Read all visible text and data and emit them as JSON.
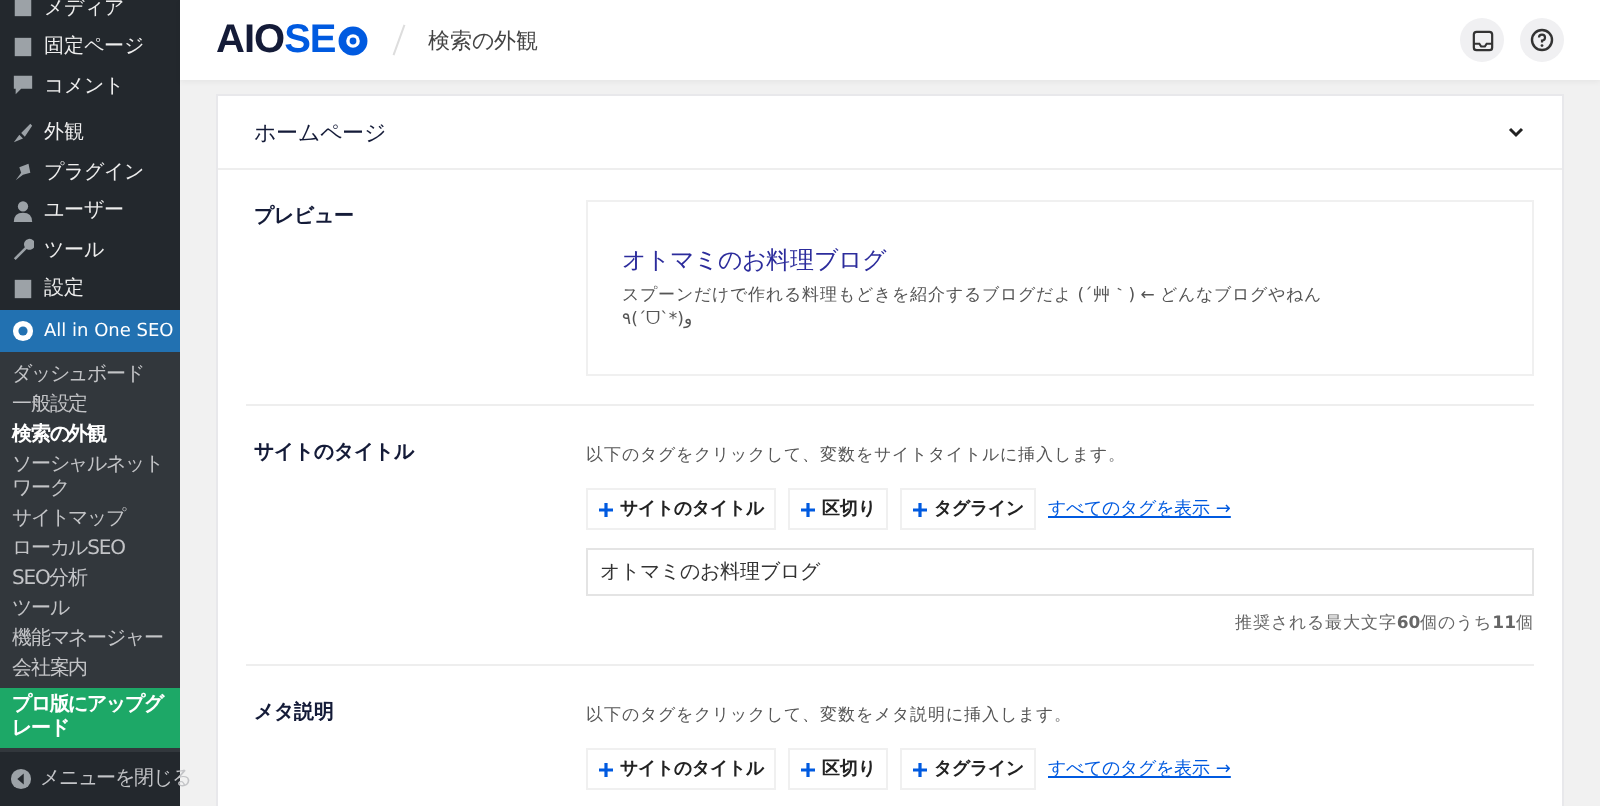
{
  "sidebar": {
    "items": [
      {
        "label": "メディア",
        "selected": false
      },
      {
        "label": "固定ページ",
        "selected": false
      },
      {
        "label": "コメント",
        "selected": false
      },
      {
        "label": "外観",
        "selected": false
      },
      {
        "label": "プラグイン",
        "selected": false
      },
      {
        "label": "ユーザー",
        "selected": false
      },
      {
        "label": "ツール",
        "selected": false
      },
      {
        "label": "設定",
        "selected": false
      },
      {
        "label": "All in One SEO",
        "selected": true
      }
    ],
    "submenu": [
      {
        "label": "ダッシュボード",
        "kind": "link",
        "selected": false
      },
      {
        "label": "一般設定",
        "kind": "link",
        "selected": false
      },
      {
        "label": "検索の外観",
        "kind": "link",
        "selected": true
      },
      {
        "label": "ソーシャルネットワーク",
        "kind": "link",
        "selected": false
      },
      {
        "label": "サイトマップ",
        "kind": "link",
        "selected": false
      },
      {
        "label": "ローカルSEO",
        "kind": "link",
        "selected": false
      },
      {
        "label": "SEO分析",
        "kind": "link",
        "selected": false
      },
      {
        "label": "ツール",
        "kind": "link",
        "selected": false
      },
      {
        "label": "機能マネージャー",
        "kind": "link",
        "selected": false
      },
      {
        "label": "会社案内",
        "kind": "link",
        "selected": false
      },
      {
        "label": "プロ版にアップグレード",
        "kind": "upgrade",
        "selected": false
      }
    ],
    "collapse": "メニューを閉じる"
  },
  "header": {
    "logo_dark": "AIO",
    "logo_blue": "SE",
    "page_title": "検索の外観"
  },
  "card": {
    "title": "ホームページ",
    "expanded": true,
    "preview": {
      "label": "プレビュー",
      "title": "オトマミのお料理ブログ",
      "description": "スプーンだけで作れる料理もどきを紹介するブログだよ (´艸｀) ← どんなブログやねん ٩(ˊᗜˋ*)و"
    },
    "site_title": {
      "label": "サイトのタイトル",
      "hint": "以下のタグをクリックして、変数をサイトタイトルに挿入します。",
      "tags": [
        "サイトのタイトル",
        "区切り",
        "タグライン"
      ],
      "view_all": "すべてのタグを表示 →",
      "value": "オトマミのお料理ブログ",
      "counter": "推奨される最大文字**60**個のうち**11**個"
    },
    "meta": {
      "label": "メタ説明",
      "hint": "以下のタグをクリックして、変数をメタ説明に挿入します。",
      "tags": [
        "サイトのタイトル",
        "区切り",
        "タグライン"
      ],
      "view_all": "すべてのタグを表示 →"
    }
  }
}
